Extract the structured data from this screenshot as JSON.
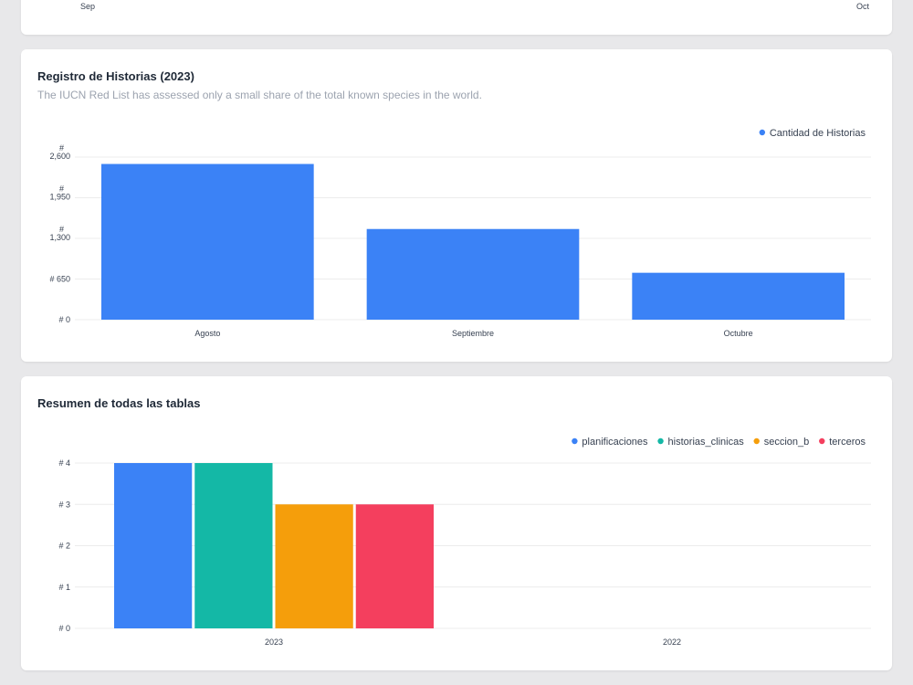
{
  "top_card": {
    "x_labels": [
      "Sep",
      "Oct"
    ]
  },
  "historias": {
    "title": "Registro de Historias (2023)",
    "subtitle": "The IUCN Red List has assessed only a small share of the total known species in the world."
  },
  "resumen": {
    "title": "Resumen de todas las tablas"
  },
  "colors": {
    "blue": "#3b82f6",
    "teal": "#14b8a6",
    "orange": "#f59e0b",
    "red": "#f43f5e"
  },
  "chart_data": [
    {
      "type": "bar",
      "title": "Registro de Historias (2023)",
      "subtitle": "The IUCN Red List has assessed only a small share of the total known species in the world.",
      "categories": [
        "Agosto",
        "Septiembre",
        "Octubre"
      ],
      "series": [
        {
          "name": "Cantidad de Historias",
          "values": [
            2490,
            1450,
            750
          ],
          "color": "#3b82f6"
        }
      ],
      "yticks": [
        0,
        650,
        1300,
        1950,
        2600
      ],
      "ytick_labels": [
        "# 0",
        "# 650",
        "#\n1,300",
        "#\n1,950",
        "#\n2,600"
      ],
      "ylim": [
        0,
        2600
      ],
      "legend": "top-right",
      "grid": true
    },
    {
      "type": "bar",
      "title": "Resumen de todas las tablas",
      "categories": [
        "2023",
        "2022"
      ],
      "series": [
        {
          "name": "planificaciones",
          "values": [
            4,
            0
          ],
          "color": "#3b82f6"
        },
        {
          "name": "historias_clinicas",
          "values": [
            4,
            0
          ],
          "color": "#14b8a6"
        },
        {
          "name": "seccion_b",
          "values": [
            3,
            0
          ],
          "color": "#f59e0b"
        },
        {
          "name": "terceros",
          "values": [
            3,
            0
          ],
          "color": "#f43f5e"
        }
      ],
      "yticks": [
        0,
        1,
        2,
        3,
        4
      ],
      "ytick_labels": [
        "# 0",
        "# 1",
        "# 2",
        "# 3",
        "# 4"
      ],
      "ylim": [
        0,
        4
      ],
      "legend": "top-right",
      "grid": true
    }
  ]
}
